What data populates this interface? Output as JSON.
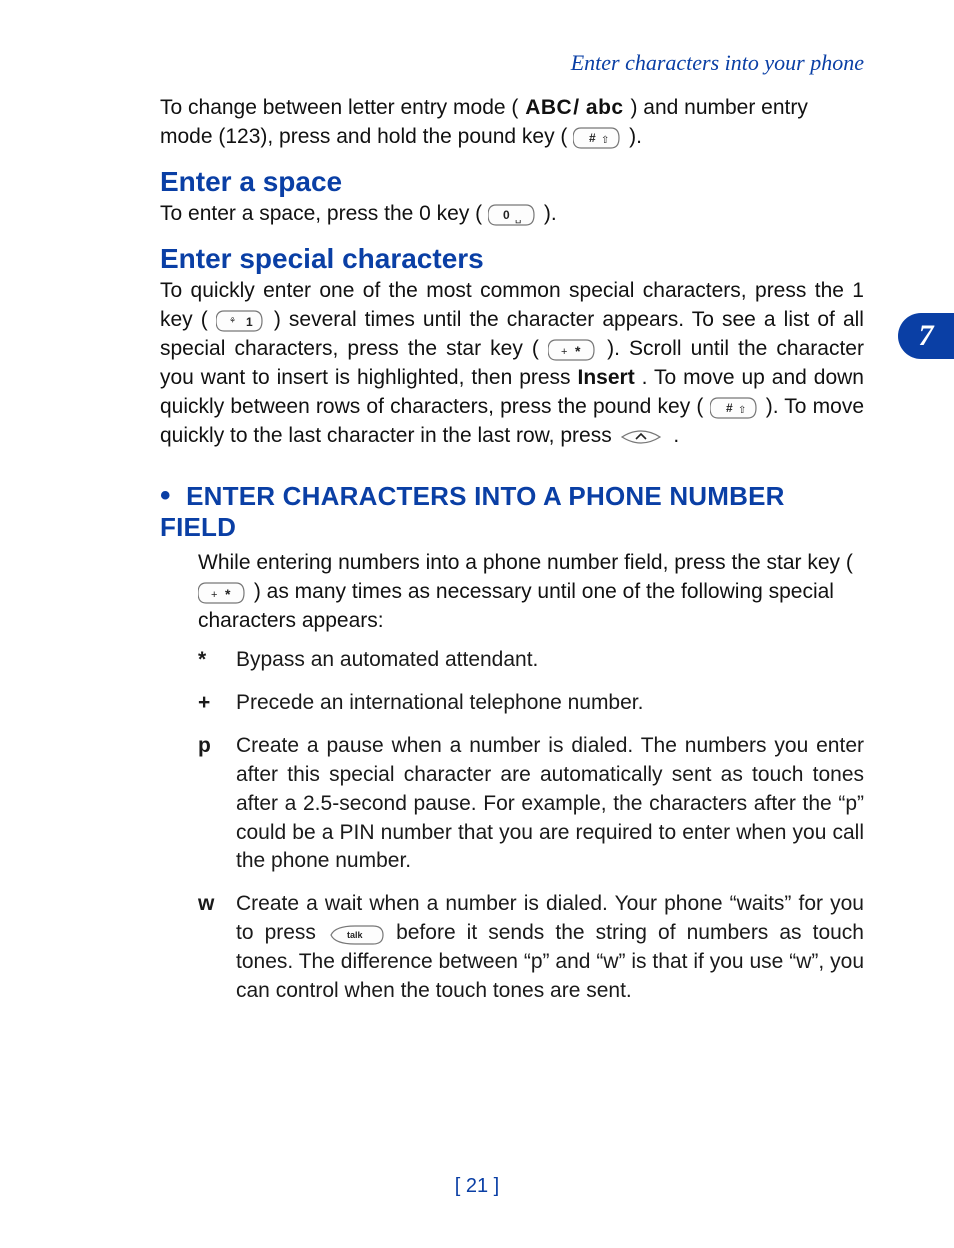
{
  "running_head": "Enter characters into your phone",
  "side_tab": "7",
  "page_number": "[ 21 ]",
  "intro": {
    "p1a": "To change between letter entry mode (",
    "p1b": ") and number entry mode (123), press and hold the pound key (",
    "p1c": ")."
  },
  "space": {
    "heading": "Enter a space",
    "p1a": "To enter a space, press the 0 key (",
    "p1b": ")."
  },
  "special": {
    "heading": "Enter special characters",
    "p1a": "To quickly enter one of the most common special characters, press the 1 key (",
    "p1b": ") several times until the character appears. To see a list of all special characters, press the star key (",
    "p1c": "). Scroll until the character you want to insert is highlighted, then press ",
    "insert": "Insert",
    "p1d": ". To move up and down quickly between rows of characters, press the pound key (",
    "p1e": "). To move quickly to the last character in the last row, press ",
    "p1f": "."
  },
  "phonefield": {
    "heading": "ENTER CHARACTERS INTO A PHONE NUMBER FIELD",
    "intro_a": "While entering numbers into a phone number field, press the star key (",
    "intro_b": ") as many times as necessary until one of the following special characters appears:",
    "defs": [
      {
        "sym": "*",
        "text_a": "Bypass an automated attendant."
      },
      {
        "sym": "+",
        "text_a": "Precede an international telephone number."
      },
      {
        "sym": "p",
        "text_a": "Create a pause when a number is dialed. The numbers you enter after this special character are automatically sent as touch tones after a 2.5-second pause. For example, the characters after the “p” could be a PIN number that you are required to enter when you call the phone number."
      },
      {
        "sym": "w",
        "text_a": "Create a wait when a number is dialed. Your phone “waits” for you to press ",
        "text_b": " before it sends the string of numbers as touch tones. The difference between “p” and “w” is that if you use “w”, you can control when the touch tones are sent."
      }
    ]
  },
  "icons": {
    "abc_upper": "ABC",
    "abc_lower": "abc",
    "sep": "/"
  }
}
